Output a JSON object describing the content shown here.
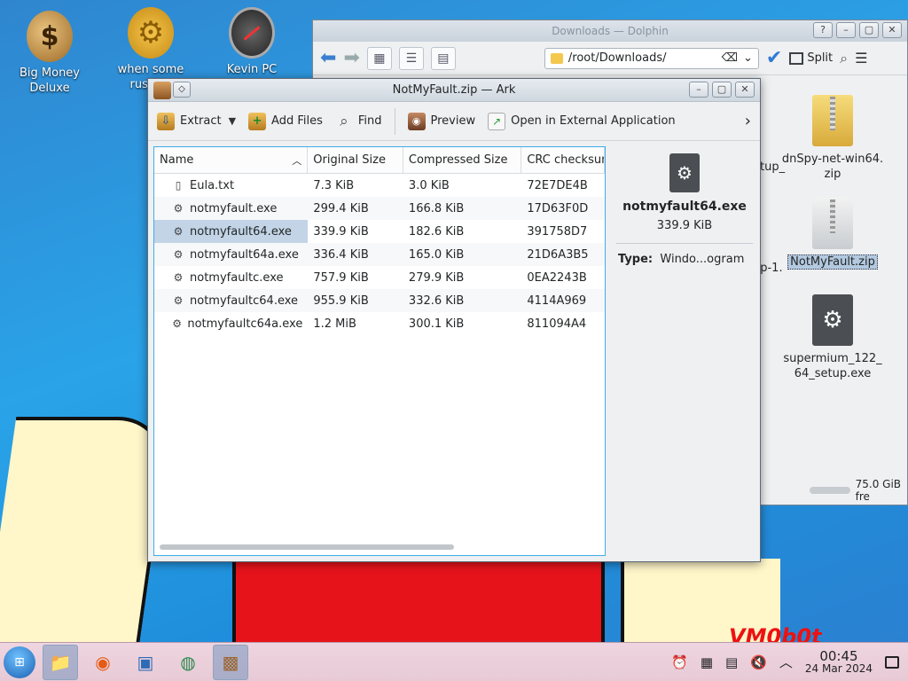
{
  "desktop": {
    "icons": [
      {
        "label": "Big Money\nDeluxe",
        "icon": "moneybag-icon"
      },
      {
        "label": "when some\nrussian",
        "icon": "gear-icon"
      },
      {
        "label": "Kevin PC\nOptimizer Ho...",
        "icon": "speedometer-icon"
      }
    ],
    "watermark": "VM0b0t"
  },
  "dolphin": {
    "title": "Downloads — Dolphin",
    "location": "/root/Downloads/",
    "split_label": "Split",
    "files": [
      {
        "name": "dnSpy-net-win64.\nzip",
        "icon": "zip-icon"
      },
      {
        "name": "NotMyFault.zip",
        "icon": "zip-icon",
        "selected": true
      },
      {
        "name": "supermium_122_\n64_setup.exe",
        "icon": "exe-icon"
      }
    ],
    "cut_labels": [
      "etup_",
      "e",
      "up-1."
    ],
    "free_space": "75.0 GiB fre"
  },
  "ark": {
    "title": "NotMyFault.zip — Ark",
    "toolbar": {
      "extract": "Extract",
      "add_files": "Add Files",
      "find": "Find",
      "preview": "Preview",
      "open_external": "Open in External Application"
    },
    "columns": [
      "Name",
      "Original Size",
      "Compressed Size",
      "CRC checksum"
    ],
    "rows": [
      {
        "name": "Eula.txt",
        "orig": "7.3 KiB",
        "comp": "3.0 KiB",
        "crc": "72E7DE4B",
        "icon": "text-file-icon"
      },
      {
        "name": "notmyfault.exe",
        "orig": "299.4 KiB",
        "comp": "166.8 KiB",
        "crc": "17D63F0D",
        "icon": "exe-icon"
      },
      {
        "name": "notmyfault64.exe",
        "orig": "339.9 KiB",
        "comp": "182.6 KiB",
        "crc": "391758D7",
        "icon": "exe-icon",
        "selected": true
      },
      {
        "name": "notmyfault64a.exe",
        "orig": "336.4 KiB",
        "comp": "165.0 KiB",
        "crc": "21D6A3B5",
        "icon": "exe-icon"
      },
      {
        "name": "notmyfaultc.exe",
        "orig": "757.9 KiB",
        "comp": "279.9 KiB",
        "crc": "0EA2243B",
        "icon": "exe-icon"
      },
      {
        "name": "notmyfaultc64.exe",
        "orig": "955.9 KiB",
        "comp": "332.6 KiB",
        "crc": "4114A969",
        "icon": "exe-icon"
      },
      {
        "name": "notmyfaultc64a.exe",
        "orig": "1.2 MiB",
        "comp": "300.1 KiB",
        "crc": "811094A4",
        "icon": "exe-icon"
      }
    ],
    "info": {
      "name": "notmyfault64.exe",
      "size": "339.9 KiB",
      "type_label": "Type:",
      "type_value": "Windo...ogram"
    }
  },
  "taskbar": {
    "time": "00:45",
    "date": "24 Mar 2024"
  }
}
